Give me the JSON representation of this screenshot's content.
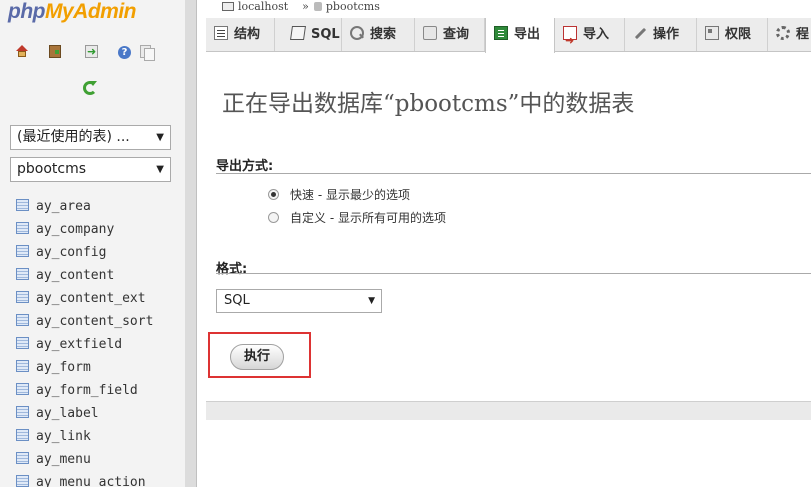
{
  "logo": {
    "php": "php",
    "admin": "MyAdmin"
  },
  "nav_icons": [
    "home-icon",
    "exit-icon",
    "query-window-icon",
    "help-icon",
    "docs-icon",
    "reload-icon"
  ],
  "sidebar": {
    "recent_select": {
      "value": "(最近使用的表) ..."
    },
    "database_select": {
      "value": "pbootcms"
    },
    "tables": [
      "ay_area",
      "ay_company",
      "ay_config",
      "ay_content",
      "ay_content_ext",
      "ay_content_sort",
      "ay_extfield",
      "ay_form",
      "ay_form_field",
      "ay_label",
      "ay_link",
      "ay_menu",
      "ay_menu_action"
    ]
  },
  "breadcrumb": {
    "server": "localhost",
    "separator": "»",
    "database": "pbootcms"
  },
  "tabs": [
    {
      "label": "结构",
      "icon": "structure-icon"
    },
    {
      "label": "SQL",
      "icon": "sql-icon"
    },
    {
      "label": "搜索",
      "icon": "search-icon"
    },
    {
      "label": "查询",
      "icon": "query-icon"
    },
    {
      "label": "导出",
      "icon": "export-icon",
      "active": true
    },
    {
      "label": "导入",
      "icon": "import-icon"
    },
    {
      "label": "操作",
      "icon": "operations-icon"
    },
    {
      "label": "权限",
      "icon": "privileges-icon"
    },
    {
      "label": "程",
      "icon": "routines-icon"
    }
  ],
  "main": {
    "title": "正在导出数据库“pbootcms”中的数据表",
    "export_method": {
      "label": "导出方式:",
      "options": [
        {
          "label": "快速 - 显示最少的选项",
          "checked": true
        },
        {
          "label": "自定义 - 显示所有可用的选项",
          "checked": false
        }
      ]
    },
    "format": {
      "label": "格式:",
      "value": "SQL"
    },
    "go_button": "执行"
  },
  "colors": {
    "accent": "#f29f00",
    "brand": "#5a6aa8",
    "highlight": "#dd3333",
    "active_tab": "#ffffff"
  }
}
